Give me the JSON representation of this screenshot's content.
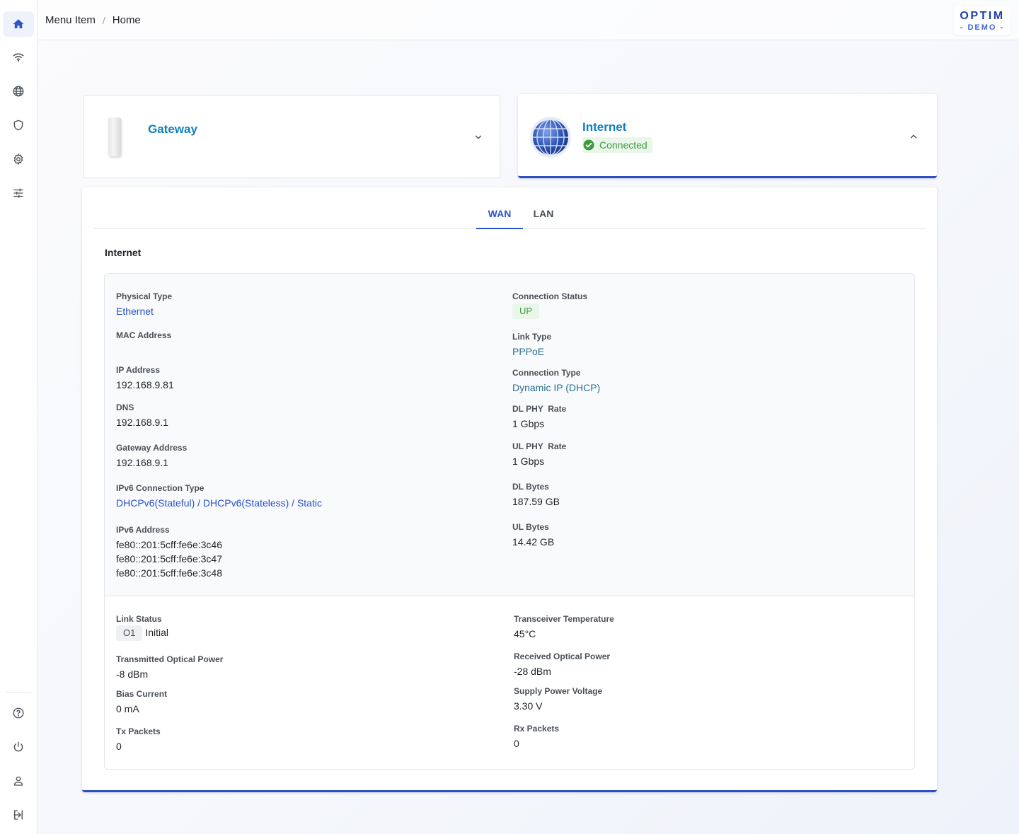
{
  "breadcrumb": {
    "parent": "Menu Item",
    "separator": "/",
    "current": "Home"
  },
  "logo": {
    "main": "OPTIM",
    "sub": "- DEMO -"
  },
  "sidebar": {
    "top_icons": [
      "home-icon",
      "wifi-icon",
      "globe-icon",
      "shield-icon",
      "settings-icon",
      "sliders-icon"
    ],
    "bottom_icons": [
      "help-icon",
      "power-icon",
      "user-icon",
      "logout-icon"
    ],
    "active": "home-icon"
  },
  "gateway_card": {
    "title": "Gateway"
  },
  "internet_card": {
    "title": "Internet",
    "status": "Connected"
  },
  "tabs": [
    "WAN",
    "LAN"
  ],
  "active_tab": "WAN",
  "section_title": "Internet",
  "wan": {
    "physical_type": {
      "label": "Physical Type",
      "value": "Ethernet"
    },
    "mac_address": {
      "label": "MAC Address",
      "value": ""
    },
    "ip_address": {
      "label": "IP Address",
      "value": "192.168.9.81"
    },
    "dns": {
      "label": "DNS",
      "value": "192.168.9.1"
    },
    "gateway_address": {
      "label": "Gateway Address",
      "value": "192.168.9.1"
    },
    "ipv6_connection_type": {
      "label": "IPv6 Connection Type",
      "value": "DHCPv6(Stateful) / DHCPv6(Stateless) / Static"
    },
    "ipv6_address": {
      "label": "IPv6 Address",
      "values": [
        "fe80::201:5cff:fe6e:3c46",
        "fe80::201:5cff:fe6e:3c47",
        "fe80::201:5cff:fe6e:3c48"
      ]
    },
    "connection_status": {
      "label": "Connection Status",
      "value": "UP"
    },
    "link_type": {
      "label": "Link Type",
      "value": "PPPoE"
    },
    "connection_type": {
      "label": "Connection Type",
      "value": "Dynamic IP (DHCP)"
    },
    "dl_phy_rate": {
      "label": "DL PHY  Rate",
      "value": "1 Gbps"
    },
    "ul_phy_rate": {
      "label": "UL PHY  Rate",
      "value": "1 Gbps"
    },
    "dl_bytes": {
      "label": "DL Bytes",
      "value": "187.59 GB"
    },
    "ul_bytes": {
      "label": "UL Bytes",
      "value": "14.42 GB"
    }
  },
  "optical": {
    "link_status": {
      "label": "Link Status",
      "code": "O1",
      "value": "Initial"
    },
    "tx_optical_power": {
      "label": "Transmitted Optical Power",
      "value": "-8 dBm"
    },
    "bias_current": {
      "label": "Bias Current",
      "value": "0 mA"
    },
    "tx_packets": {
      "label": "Tx Packets",
      "value": "0"
    },
    "transceiver_temp": {
      "label": "Transceiver Temperature",
      "value": "45°C"
    },
    "rx_optical_power": {
      "label": "Received Optical Power",
      "value": "-28 dBm"
    },
    "supply_voltage": {
      "label": "Supply Power Voltage",
      "value": "3.30 V"
    },
    "rx_packets": {
      "label": "Rx Packets",
      "value": "0"
    }
  },
  "colors": {
    "accent": "#2d55c8",
    "title_blue": "#0e7fbf",
    "success": "#3e9a3e"
  }
}
